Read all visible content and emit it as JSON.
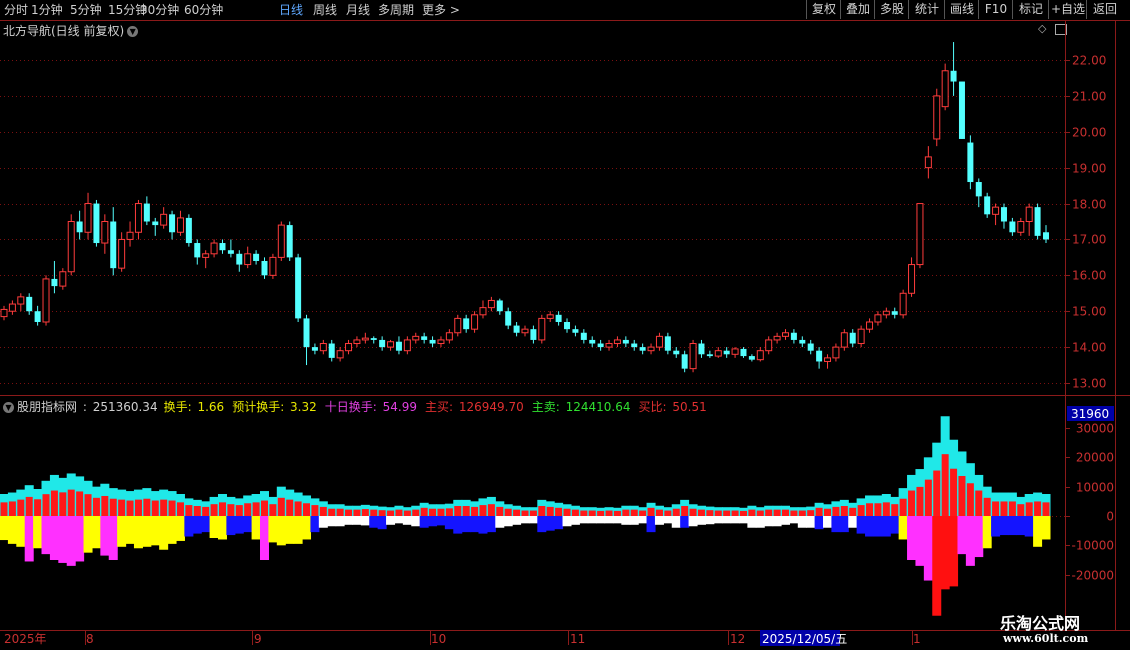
{
  "periods": [
    {
      "label": "分时",
      "active": false
    },
    {
      "label": "1分钟",
      "active": false
    },
    {
      "label": "5分钟",
      "active": false
    },
    {
      "label": "15分钟",
      "active": false
    },
    {
      "label": "30分钟",
      "active": false
    },
    {
      "label": "60分钟",
      "active": false
    },
    {
      "label": "日线",
      "active": true
    },
    {
      "label": "周线",
      "active": false
    },
    {
      "label": "月线",
      "active": false
    },
    {
      "label": "多周期",
      "active": false
    },
    {
      "label": "更多 >",
      "active": false
    }
  ],
  "toolbar": [
    "复权",
    "叠加",
    "多股",
    "统计",
    "画线",
    "F10",
    "标记",
    "+自选",
    "返回"
  ],
  "stock": {
    "title": "北方导航(日线 前复权)"
  },
  "indicator": {
    "name": "股朋指标网",
    "value": "251360.34",
    "items": [
      {
        "label": "换手:",
        "value": "1.66",
        "color": "#e8e800"
      },
      {
        "label": "预计换手:",
        "value": "3.32",
        "color": "#e8e800"
      },
      {
        "label": "十日换手:",
        "value": "54.99",
        "color": "#e040e0"
      },
      {
        "label": "主买:",
        "value": "126949.70",
        "color": "#e03030"
      },
      {
        "label": "主卖:",
        "value": "124410.64",
        "color": "#30e030"
      },
      {
        "label": "买比:",
        "value": "50.51",
        "color": "#e03030"
      }
    ],
    "badge": "31960"
  },
  "price_axis": [
    "22.00",
    "21.00",
    "20.00",
    "19.00",
    "18.00",
    "17.00",
    "16.00",
    "15.00",
    "14.00",
    "13.00"
  ],
  "vol_axis": [
    "30000",
    "20000",
    "10000",
    "0",
    "-10000",
    "-20000"
  ],
  "date_axis": [
    {
      "label": "2025年",
      "highlight": false
    },
    {
      "label": "8",
      "highlight": false
    },
    {
      "label": "9",
      "highlight": false
    },
    {
      "label": "10",
      "highlight": false
    },
    {
      "label": "11",
      "highlight": false
    },
    {
      "label": "12",
      "highlight": false
    },
    {
      "label": "2025/12/05/五",
      "highlight": true
    },
    {
      "label": "1",
      "highlight": false
    }
  ],
  "watermark": {
    "title": "乐淘公式网",
    "url": "www.60lt.com"
  },
  "chart_data": {
    "type": "candlestick",
    "price_range": [
      12.7,
      22.9
    ],
    "candles": [
      [
        14.85,
        15.15,
        14.75,
        15.05
      ],
      [
        15.0,
        15.3,
        14.9,
        15.2
      ],
      [
        15.2,
        15.5,
        15.0,
        15.4
      ],
      [
        15.4,
        15.5,
        14.9,
        15.0
      ],
      [
        15.0,
        15.15,
        14.6,
        14.7
      ],
      [
        14.7,
        16.0,
        14.6,
        15.9
      ],
      [
        15.9,
        16.4,
        15.5,
        15.7
      ],
      [
        15.7,
        16.2,
        15.6,
        16.1
      ],
      [
        16.1,
        17.7,
        16.0,
        17.5
      ],
      [
        17.5,
        17.8,
        17.0,
        17.2
      ],
      [
        17.2,
        18.3,
        17.0,
        18.0
      ],
      [
        18.0,
        18.1,
        16.8,
        16.9
      ],
      [
        16.9,
        17.7,
        16.6,
        17.5
      ],
      [
        17.5,
        17.9,
        16.0,
        16.2
      ],
      [
        16.2,
        17.2,
        16.1,
        17.0
      ],
      [
        17.0,
        17.5,
        16.8,
        17.2
      ],
      [
        17.2,
        18.1,
        17.0,
        18.0
      ],
      [
        18.0,
        18.2,
        17.4,
        17.5
      ],
      [
        17.5,
        17.6,
        17.1,
        17.4
      ],
      [
        17.4,
        17.9,
        17.3,
        17.7
      ],
      [
        17.7,
        17.8,
        17.0,
        17.2
      ],
      [
        17.2,
        17.8,
        17.1,
        17.6
      ],
      [
        17.6,
        17.7,
        16.8,
        16.9
      ],
      [
        16.9,
        17.0,
        16.3,
        16.5
      ],
      [
        16.5,
        16.7,
        16.2,
        16.6
      ],
      [
        16.6,
        17.0,
        16.5,
        16.9
      ],
      [
        16.9,
        17.0,
        16.6,
        16.7
      ],
      [
        16.7,
        17.0,
        16.5,
        16.6
      ],
      [
        16.6,
        16.7,
        16.1,
        16.3
      ],
      [
        16.3,
        16.8,
        16.2,
        16.6
      ],
      [
        16.6,
        16.7,
        16.3,
        16.4
      ],
      [
        16.4,
        16.5,
        15.9,
        16.0
      ],
      [
        16.0,
        16.6,
        15.9,
        16.5
      ],
      [
        16.5,
        17.5,
        16.4,
        17.4
      ],
      [
        17.4,
        17.5,
        16.4,
        16.5
      ],
      [
        16.5,
        16.6,
        14.7,
        14.8
      ],
      [
        14.8,
        14.9,
        13.5,
        14.0
      ],
      [
        14.0,
        14.1,
        13.8,
        13.9
      ],
      [
        13.9,
        14.2,
        13.8,
        14.1
      ],
      [
        14.1,
        14.2,
        13.6,
        13.7
      ],
      [
        13.7,
        14.0,
        13.6,
        13.9
      ],
      [
        13.9,
        14.2,
        13.8,
        14.1
      ],
      [
        14.1,
        14.3,
        14.0,
        14.2
      ],
      [
        14.2,
        14.4,
        14.1,
        14.25
      ],
      [
        14.25,
        14.3,
        14.1,
        14.2
      ],
      [
        14.2,
        14.3,
        13.9,
        14.0
      ],
      [
        14.0,
        14.2,
        13.9,
        14.15
      ],
      [
        14.15,
        14.3,
        13.8,
        13.9
      ],
      [
        13.9,
        14.3,
        13.8,
        14.2
      ],
      [
        14.2,
        14.4,
        14.1,
        14.3
      ],
      [
        14.3,
        14.4,
        14.1,
        14.2
      ],
      [
        14.2,
        14.3,
        14.0,
        14.1
      ],
      [
        14.1,
        14.3,
        14.0,
        14.2
      ],
      [
        14.2,
        14.5,
        14.1,
        14.4
      ],
      [
        14.4,
        14.9,
        14.3,
        14.8
      ],
      [
        14.8,
        14.9,
        14.4,
        14.5
      ],
      [
        14.5,
        15.0,
        14.4,
        14.9
      ],
      [
        14.9,
        15.3,
        14.8,
        15.1
      ],
      [
        15.1,
        15.4,
        15.0,
        15.3
      ],
      [
        15.3,
        15.35,
        14.9,
        15.0
      ],
      [
        15.0,
        15.1,
        14.5,
        14.6
      ],
      [
        14.6,
        14.7,
        14.3,
        14.4
      ],
      [
        14.4,
        14.6,
        14.3,
        14.5
      ],
      [
        14.5,
        14.6,
        14.1,
        14.2
      ],
      [
        14.2,
        14.9,
        14.1,
        14.8
      ],
      [
        14.8,
        15.0,
        14.7,
        14.9
      ],
      [
        14.9,
        15.0,
        14.6,
        14.7
      ],
      [
        14.7,
        14.8,
        14.4,
        14.5
      ],
      [
        14.5,
        14.6,
        14.3,
        14.4
      ],
      [
        14.4,
        14.5,
        14.1,
        14.2
      ],
      [
        14.2,
        14.3,
        14.0,
        14.1
      ],
      [
        14.1,
        14.2,
        13.9,
        14.0
      ],
      [
        14.0,
        14.2,
        13.9,
        14.1
      ],
      [
        14.1,
        14.3,
        14.0,
        14.2
      ],
      [
        14.2,
        14.3,
        14.0,
        14.1
      ],
      [
        14.1,
        14.2,
        13.9,
        14.0
      ],
      [
        14.0,
        14.1,
        13.8,
        13.9
      ],
      [
        13.9,
        14.1,
        13.8,
        14.0
      ],
      [
        14.0,
        14.4,
        13.9,
        14.3
      ],
      [
        14.3,
        14.4,
        13.8,
        13.9
      ],
      [
        13.9,
        14.0,
        13.7,
        13.8
      ],
      [
        13.8,
        13.9,
        13.3,
        13.4
      ],
      [
        13.4,
        14.2,
        13.3,
        14.1
      ],
      [
        14.1,
        14.2,
        13.7,
        13.8
      ],
      [
        13.8,
        13.9,
        13.7,
        13.75
      ],
      [
        13.75,
        14.0,
        13.7,
        13.9
      ],
      [
        13.9,
        14.0,
        13.7,
        13.8
      ],
      [
        13.8,
        14.0,
        13.7,
        13.95
      ],
      [
        13.95,
        14.0,
        13.7,
        13.75
      ],
      [
        13.75,
        13.8,
        13.6,
        13.65
      ],
      [
        13.65,
        14.0,
        13.6,
        13.9
      ],
      [
        13.9,
        14.3,
        13.8,
        14.2
      ],
      [
        14.2,
        14.4,
        14.1,
        14.3
      ],
      [
        14.3,
        14.5,
        14.2,
        14.4
      ],
      [
        14.4,
        14.5,
        14.1,
        14.2
      ],
      [
        14.2,
        14.3,
        14.0,
        14.1
      ],
      [
        14.1,
        14.2,
        13.8,
        13.9
      ],
      [
        13.9,
        14.0,
        13.4,
        13.6
      ],
      [
        13.6,
        13.8,
        13.4,
        13.7
      ],
      [
        13.7,
        14.1,
        13.6,
        14.0
      ],
      [
        14.0,
        14.5,
        13.9,
        14.4
      ],
      [
        14.4,
        14.5,
        14.0,
        14.1
      ],
      [
        14.1,
        14.6,
        14.0,
        14.5
      ],
      [
        14.5,
        14.8,
        14.4,
        14.7
      ],
      [
        14.7,
        15.0,
        14.6,
        14.9
      ],
      [
        14.9,
        15.1,
        14.8,
        15.0
      ],
      [
        15.0,
        15.1,
        14.8,
        14.9
      ],
      [
        14.9,
        15.6,
        14.8,
        15.5
      ],
      [
        15.5,
        16.5,
        15.4,
        16.3
      ],
      [
        16.3,
        18.0,
        16.2,
        18.0
      ],
      [
        19.0,
        19.6,
        18.7,
        19.3
      ],
      [
        19.8,
        21.2,
        19.6,
        21.0
      ],
      [
        20.7,
        21.9,
        20.6,
        21.7
      ],
      [
        21.7,
        22.5,
        21.0,
        21.4
      ],
      [
        21.4,
        21.4,
        19.8,
        19.8
      ],
      [
        19.7,
        19.9,
        18.4,
        18.6
      ],
      [
        18.6,
        18.7,
        17.9,
        18.2
      ],
      [
        18.2,
        18.3,
        17.6,
        17.7
      ],
      [
        17.7,
        18.0,
        17.4,
        17.9
      ],
      [
        17.9,
        18.0,
        17.3,
        17.5
      ],
      [
        17.5,
        17.6,
        17.1,
        17.2
      ],
      [
        17.2,
        17.6,
        17.1,
        17.5
      ],
      [
        17.5,
        18.0,
        17.1,
        17.9
      ],
      [
        17.9,
        18.0,
        17.0,
        17.1
      ],
      [
        17.2,
        17.4,
        16.9,
        17.0
      ]
    ],
    "volume": [
      [
        7500,
        -8200,
        "yellow"
      ],
      [
        8000,
        -9500,
        "yellow"
      ],
      [
        9000,
        -10500,
        "yellow"
      ],
      [
        10500,
        -15500,
        "magenta"
      ],
      [
        9200,
        -11000,
        "yellow"
      ],
      [
        12000,
        -13000,
        "magenta"
      ],
      [
        14000,
        -15000,
        "magenta"
      ],
      [
        13000,
        -16000,
        "magenta"
      ],
      [
        14500,
        -17000,
        "magenta"
      ],
      [
        13500,
        -15500,
        "magenta"
      ],
      [
        12000,
        -12500,
        "yellow"
      ],
      [
        10000,
        -11000,
        "yellow"
      ],
      [
        11000,
        -13500,
        "magenta"
      ],
      [
        9500,
        -15000,
        "magenta"
      ],
      [
        9000,
        -10500,
        "yellow"
      ],
      [
        8500,
        -9500,
        "yellow"
      ],
      [
        9000,
        -11000,
        "yellow"
      ],
      [
        9500,
        -10500,
        "yellow"
      ],
      [
        8500,
        -10000,
        "yellow"
      ],
      [
        9000,
        -11500,
        "yellow"
      ],
      [
        8500,
        -9500,
        "yellow"
      ],
      [
        7500,
        -8500,
        "yellow"
      ],
      [
        6000,
        -7000,
        "blue"
      ],
      [
        5500,
        -6000,
        "blue"
      ],
      [
        5000,
        -5500,
        "blue"
      ],
      [
        6500,
        -7500,
        "yellow"
      ],
      [
        7500,
        -8000,
        "yellow"
      ],
      [
        6500,
        -6500,
        "blue"
      ],
      [
        6000,
        -6000,
        "blue"
      ],
      [
        7000,
        -5500,
        "blue"
      ],
      [
        7500,
        -8000,
        "yellow"
      ],
      [
        8500,
        -15000,
        "magenta"
      ],
      [
        6500,
        -9000,
        "yellow"
      ],
      [
        10000,
        -10000,
        "yellow"
      ],
      [
        9000,
        -9500,
        "yellow"
      ],
      [
        8000,
        -9500,
        "yellow"
      ],
      [
        7000,
        -8000,
        "yellow"
      ],
      [
        6000,
        -5500,
        "blue"
      ],
      [
        5000,
        -4000,
        "white"
      ],
      [
        4000,
        -3500,
        "white"
      ],
      [
        4000,
        -3500,
        "white"
      ],
      [
        3500,
        -3000,
        "white"
      ],
      [
        3500,
        -3000,
        "white"
      ],
      [
        3800,
        -3200,
        "white"
      ],
      [
        3500,
        -4000,
        "blue"
      ],
      [
        3200,
        -4500,
        "blue"
      ],
      [
        3000,
        -3000,
        "white"
      ],
      [
        3500,
        -2500,
        "white"
      ],
      [
        3000,
        -3000,
        "white"
      ],
      [
        3500,
        -3500,
        "white"
      ],
      [
        4500,
        -4000,
        "blue"
      ],
      [
        4000,
        -3500,
        "blue"
      ],
      [
        4000,
        -3200,
        "blue"
      ],
      [
        4200,
        -4500,
        "blue"
      ],
      [
        5500,
        -6000,
        "blue"
      ],
      [
        5500,
        -5500,
        "blue"
      ],
      [
        5000,
        -5500,
        "blue"
      ],
      [
        6000,
        -6000,
        "blue"
      ],
      [
        6500,
        -5500,
        "blue"
      ],
      [
        5000,
        -4000,
        "white"
      ],
      [
        4000,
        -3500,
        "white"
      ],
      [
        3500,
        -3000,
        "white"
      ],
      [
        3000,
        -2500,
        "white"
      ],
      [
        3000,
        -2500,
        "white"
      ],
      [
        5500,
        -5500,
        "blue"
      ],
      [
        5000,
        -5000,
        "blue"
      ],
      [
        4500,
        -4500,
        "blue"
      ],
      [
        4000,
        -3500,
        "white"
      ],
      [
        3500,
        -3000,
        "white"
      ],
      [
        3000,
        -2500,
        "white"
      ],
      [
        3000,
        -2500,
        "white"
      ],
      [
        2800,
        -2500,
        "white"
      ],
      [
        3000,
        -2500,
        "white"
      ],
      [
        2800,
        -2500,
        "white"
      ],
      [
        3500,
        -3000,
        "white"
      ],
      [
        3500,
        -3000,
        "white"
      ],
      [
        3000,
        -2500,
        "white"
      ],
      [
        4500,
        -5500,
        "blue"
      ],
      [
        3500,
        -3000,
        "white"
      ],
      [
        3000,
        -2500,
        "white"
      ],
      [
        4000,
        -4000,
        "white"
      ],
      [
        5500,
        -4000,
        "blue"
      ],
      [
        4000,
        -3500,
        "white"
      ],
      [
        3500,
        -3000,
        "white"
      ],
      [
        3200,
        -2800,
        "white"
      ],
      [
        3000,
        -2500,
        "white"
      ],
      [
        3000,
        -2500,
        "white"
      ],
      [
        3000,
        -2500,
        "white"
      ],
      [
        2800,
        -2500,
        "white"
      ],
      [
        3500,
        -4000,
        "white"
      ],
      [
        3000,
        -4000,
        "white"
      ],
      [
        3500,
        -3500,
        "white"
      ],
      [
        3500,
        -3500,
        "white"
      ],
      [
        3500,
        -3000,
        "white"
      ],
      [
        3000,
        -2500,
        "white"
      ],
      [
        3000,
        -4000,
        "white"
      ],
      [
        3200,
        -4000,
        "white"
      ],
      [
        4500,
        -4500,
        "blue"
      ],
      [
        4000,
        -4000,
        "white"
      ],
      [
        5000,
        -5500,
        "blue"
      ],
      [
        5500,
        -5500,
        "blue"
      ],
      [
        4500,
        -4000,
        "white"
      ],
      [
        6000,
        -6000,
        "blue"
      ],
      [
        7000,
        -7000,
        "blue"
      ],
      [
        7000,
        -7000,
        "blue"
      ],
      [
        7500,
        -7000,
        "blue"
      ],
      [
        6500,
        -6000,
        "blue"
      ],
      [
        9500,
        -8000,
        "yellow"
      ],
      [
        14000,
        -15000,
        "magenta"
      ],
      [
        16000,
        -17000,
        "magenta"
      ],
      [
        20000,
        -22000,
        "magenta"
      ],
      [
        25000,
        -34000,
        "red"
      ],
      [
        34000,
        -25000,
        "red"
      ],
      [
        26000,
        -24000,
        "red"
      ],
      [
        22000,
        -13000,
        "magenta"
      ],
      [
        18000,
        -17000,
        "magenta"
      ],
      [
        14000,
        -14000,
        "magenta"
      ],
      [
        10000,
        -11000,
        "yellow"
      ],
      [
        8000,
        -7000,
        "blue"
      ],
      [
        8000,
        -6500,
        "blue"
      ],
      [
        8000,
        -6500,
        "blue"
      ],
      [
        6500,
        -6500,
        "blue"
      ],
      [
        7500,
        -7000,
        "blue"
      ],
      [
        8000,
        -10500,
        "yellow"
      ],
      [
        7500,
        -8000,
        "yellow"
      ]
    ]
  }
}
